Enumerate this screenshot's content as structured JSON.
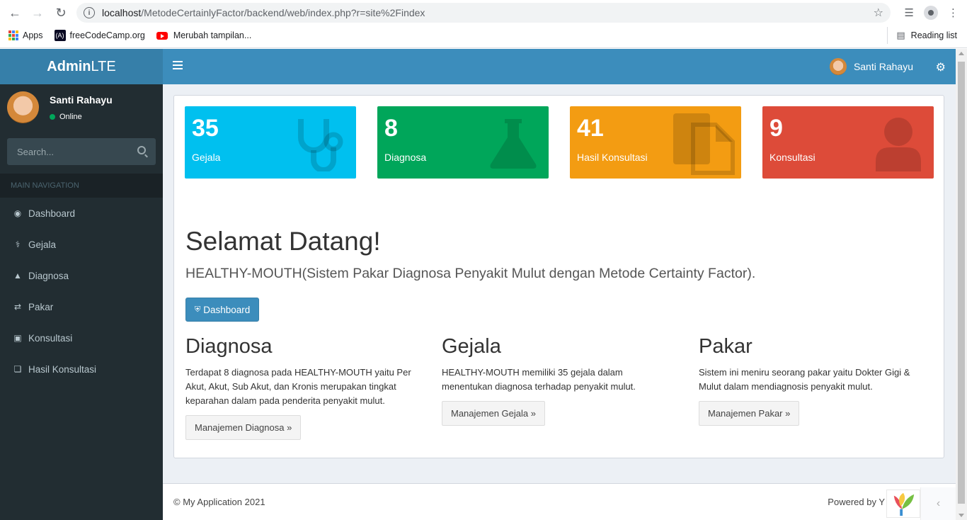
{
  "browser": {
    "url_host": "localhost",
    "url_path": "/MetodeCertainlyFactor/backend/web/index.php?r=site%2Findex",
    "bookmarks": [
      "Apps",
      "freeCodeCamp.org",
      "Merubah tampilan..."
    ],
    "reading_list": "Reading list",
    "fcc_badge": "(A)"
  },
  "header": {
    "logo_bold": "Admin",
    "logo_rest": "LTE",
    "user_name": "Santi Rahayu"
  },
  "sidebar": {
    "user_name": "Santi Rahayu",
    "status": "Online",
    "search_placeholder": "Search...",
    "section_label": "MAIN NAVIGATION",
    "items": [
      {
        "label": "Dashboard",
        "icon": "dashboard-icon"
      },
      {
        "label": "Gejala",
        "icon": "stethoscope-icon"
      },
      {
        "label": "Diagnosa",
        "icon": "flask-icon"
      },
      {
        "label": "Pakar",
        "icon": "random-icon"
      },
      {
        "label": "Konsultasi",
        "icon": "medkit-icon"
      },
      {
        "label": "Hasil Konsultasi",
        "icon": "files-icon"
      }
    ]
  },
  "tiles": [
    {
      "value": "35",
      "label": "Gejala",
      "color": "#00c0ef",
      "icon": "stethoscope-icon"
    },
    {
      "value": "8",
      "label": "Diagnosa",
      "color": "#00a65a",
      "icon": "flask-icon"
    },
    {
      "value": "41",
      "label": "Hasil Konsultasi",
      "color": "#f39c12",
      "icon": "files-icon"
    },
    {
      "value": "9",
      "label": "Konsultasi",
      "color": "#dd4b39",
      "icon": "user-icon"
    }
  ],
  "main": {
    "welcome": "Selamat Datang!",
    "lead": "HEALTHY-MOUTH(Sistem Pakar Diagnosa Penyakit Mulut dengan Metode Certainty Factor).",
    "dashboard_button": "Dashboard",
    "columns": [
      {
        "title": "Diagnosa",
        "text": "Terdapat 8 diagnosa pada HEALTHY-MOUTH yaitu Per Akut, Akut, Sub Akut, dan Kronis merupakan tingkat keparahan dalam pada penderita penyakit mulut.",
        "button": "Manajemen Diagnosa »"
      },
      {
        "title": "Gejala",
        "text": "HEALTHY-MOUTH memiliki 35 gejala dalam menentukan diagnosa terhadap penyakit mulut.",
        "button": "Manajemen Gejala »"
      },
      {
        "title": "Pakar",
        "text": "Sistem ini meniru seorang pakar yaitu Dokter Gigi & Mulut dalam mendiagnosis penyakit mulut.",
        "button": "Manajemen Pakar »"
      }
    ]
  },
  "footer": {
    "copyright": "© My Application 2021",
    "powered": "Powered by Y"
  }
}
